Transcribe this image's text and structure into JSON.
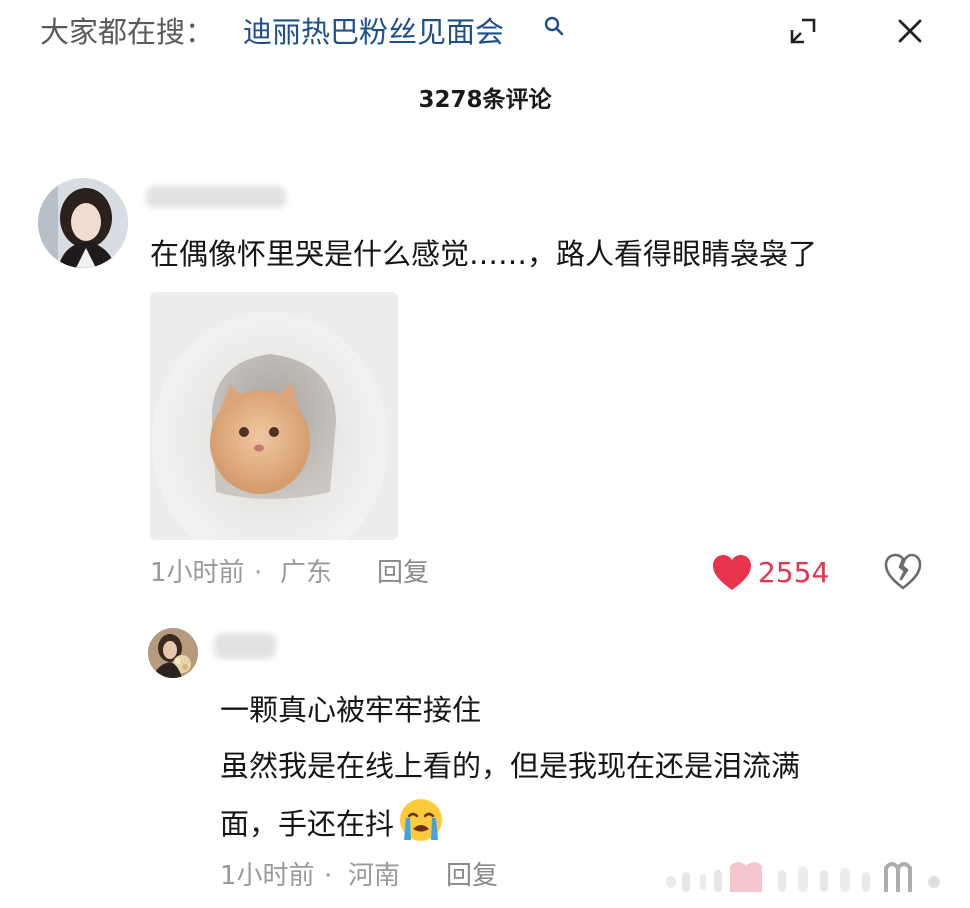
{
  "search_bar": {
    "prefix": "大家都在搜：",
    "query": "迪丽热巴粉丝见面会",
    "search_icon": "search-icon",
    "minimize_icon": "minimize-icon",
    "close_icon": "close-icon"
  },
  "comments_header": {
    "count_label": "3278条评论"
  },
  "comment": {
    "avatar_icon": "avatar",
    "text": "在偶像怀里哭是什么感觉……，路人看得眼睛袅袅了",
    "image_icon": "kitten-in-toilet-image",
    "time": "1小时前",
    "separator": "·",
    "location": "广东",
    "reply_label": "回复",
    "like_count": "2554",
    "colors": {
      "like": "#e8334d",
      "meta": "#9a9a9a",
      "query": "#1d4f8e"
    }
  },
  "reply": {
    "avatar_icon": "avatar",
    "line1": "一颗真心被牢牢接住",
    "line2": "虽然我是在线上看的，但是我现在还是泪流满",
    "line3": "面，手还在抖",
    "emoji_icon": "loudly-crying-face-icon",
    "time": "1小时前",
    "separator": "·",
    "location": "河南",
    "reply_label": "回复"
  }
}
